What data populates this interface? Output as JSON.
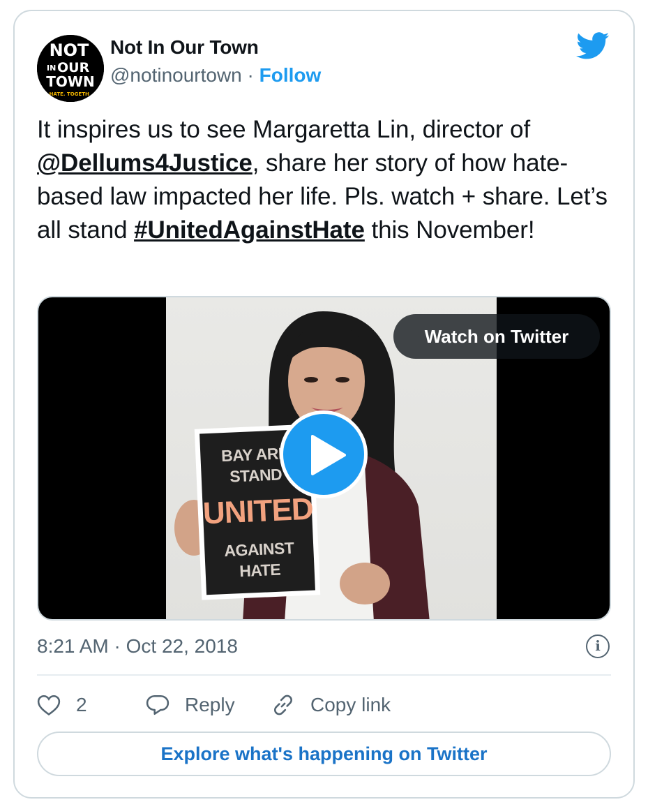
{
  "tweet": {
    "author_name": "Not In Our Town",
    "handle": "@notinourtown",
    "separator": "·",
    "follow_label": "Follow",
    "avatar_text": {
      "line1": "NOT",
      "line2_small": "IN",
      "line2": "OUR",
      "line3": "TOWN",
      "tagline": "P HATE. TOGETH"
    },
    "text_parts": {
      "p1": "It inspires us to see Margaretta Lin, director of ",
      "mention": "@Dellums4Justice",
      "p2": ", share her story of how hate-based law impacted her life. Pls. watch + share. Let’s all stand ",
      "hashtag": "#UnitedAgainstHate",
      "p3": " this November!"
    },
    "media": {
      "watch_label": "Watch on Twitter",
      "sign_lines": [
        "BAY ARE",
        "STAND",
        "UNITED",
        "AGAINST",
        "HATE"
      ]
    },
    "time": "8:21 AM",
    "date": "Oct 22, 2018",
    "info_glyph": "i",
    "actions": {
      "like_count": "2",
      "reply_label": "Reply",
      "copy_label": "Copy link"
    },
    "explore_label": "Explore what's happening on Twitter"
  },
  "colors": {
    "accent": "#1d9bf0",
    "secondary_text": "#536471",
    "border": "#cfd9de",
    "explore_text": "#1a73c7"
  },
  "icons": [
    "twitter-bird-icon",
    "play-icon",
    "info-icon",
    "heart-icon",
    "reply-bubble-icon",
    "link-icon"
  ]
}
